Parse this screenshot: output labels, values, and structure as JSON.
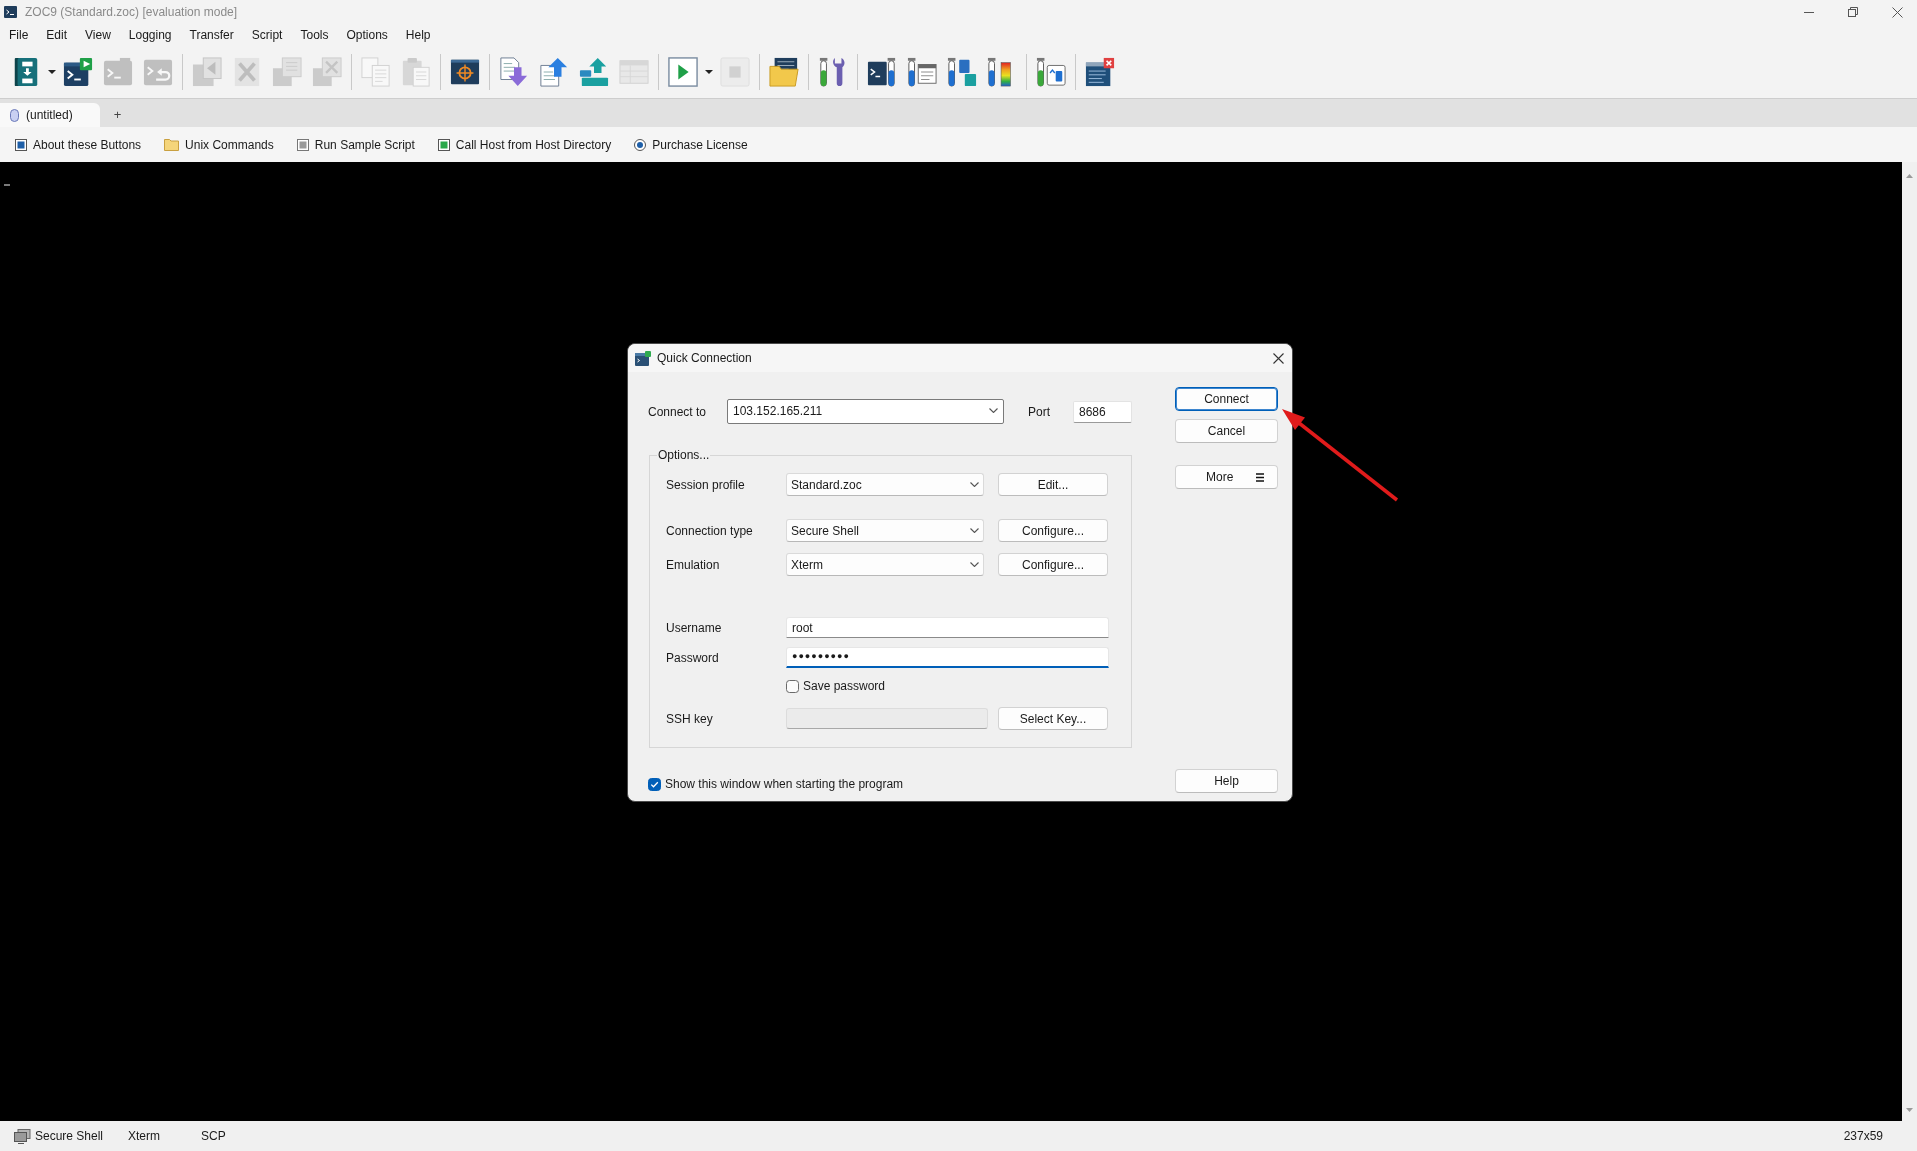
{
  "window": {
    "title": "ZOC9 (Standard.zoc) [evaluation mode]"
  },
  "menu": [
    "File",
    "Edit",
    "View",
    "Logging",
    "Transfer",
    "Script",
    "Tools",
    "Options",
    "Help"
  ],
  "toolbar": {
    "items": [
      {
        "kind": "button",
        "disabled": false
      },
      {
        "kind": "caret",
        "disabled": false
      },
      {
        "kind": "button",
        "disabled": false
      },
      {
        "kind": "button",
        "disabled": true
      },
      {
        "kind": "button",
        "disabled": true
      },
      {
        "kind": "separator"
      },
      {
        "kind": "button",
        "disabled": true
      },
      {
        "kind": "button",
        "disabled": true
      },
      {
        "kind": "button",
        "disabled": true
      },
      {
        "kind": "button",
        "disabled": true
      },
      {
        "kind": "separator"
      },
      {
        "kind": "button",
        "disabled": true
      },
      {
        "kind": "button",
        "disabled": true
      },
      {
        "kind": "separator"
      },
      {
        "kind": "button",
        "disabled": false
      },
      {
        "kind": "separator"
      },
      {
        "kind": "button",
        "disabled": false
      },
      {
        "kind": "button",
        "disabled": false
      },
      {
        "kind": "button",
        "disabled": false
      },
      {
        "kind": "button",
        "disabled": true
      },
      {
        "kind": "separator"
      },
      {
        "kind": "button",
        "disabled": false
      },
      {
        "kind": "caret",
        "disabled": false
      },
      {
        "kind": "button",
        "disabled": true
      },
      {
        "kind": "separator"
      },
      {
        "kind": "button",
        "disabled": false
      },
      {
        "kind": "separator"
      },
      {
        "kind": "button",
        "disabled": false
      },
      {
        "kind": "separator"
      },
      {
        "kind": "button",
        "disabled": false
      },
      {
        "kind": "button",
        "disabled": false
      },
      {
        "kind": "button",
        "disabled": false
      },
      {
        "kind": "button",
        "disabled": false
      },
      {
        "kind": "separator"
      },
      {
        "kind": "button",
        "disabled": false
      },
      {
        "kind": "separator"
      },
      {
        "kind": "button",
        "disabled": false
      }
    ]
  },
  "tabs": [
    {
      "label": "(untitled)",
      "selected": true
    }
  ],
  "new_tab": "+",
  "button_bar": [
    {
      "label": "About these Buttons"
    },
    {
      "label": "Unix Commands"
    },
    {
      "label": "Run Sample Script"
    },
    {
      "label": "Call Host from Host Directory"
    },
    {
      "label": "Purchase License"
    }
  ],
  "dialog": {
    "title": "Quick Connection",
    "connect_to": {
      "label": "Connect to",
      "value": "103.152.165.211"
    },
    "port": {
      "label": "Port",
      "value": "8686"
    },
    "options": {
      "legend": "Options...",
      "rows": [
        {
          "kind": "combo",
          "label": "Session profile",
          "value": "Standard.zoc",
          "button": "Edit..."
        },
        {
          "kind": "combo",
          "label": "Connection type",
          "value": "Secure Shell",
          "button": "Configure..."
        },
        {
          "kind": "combo",
          "label": "Emulation",
          "value": "Xterm",
          "button": "Configure..."
        },
        {
          "kind": "text",
          "label": "Username",
          "value": "root",
          "focused": false
        },
        {
          "kind": "text",
          "label": "Password",
          "value": "●●●●●●●●●",
          "focused": true
        },
        {
          "kind": "checkbox",
          "label": "Save password",
          "checked": false
        },
        {
          "kind": "key",
          "label": "SSH key",
          "disabled": true,
          "button": "Select Key..."
        }
      ]
    },
    "show_on_start": {
      "label": "Show this window when starting the program",
      "checked": true
    },
    "buttons": [
      {
        "label": "Connect",
        "kind": "push",
        "default": true
      },
      {
        "label": "Cancel",
        "kind": "push",
        "default": false
      },
      {
        "label": "More",
        "kind": "menu",
        "default": false
      },
      {
        "label": "Help",
        "kind": "push",
        "default": false
      }
    ]
  },
  "status_bar": {
    "items": [
      "Secure Shell",
      "Xterm",
      "SCP"
    ],
    "terminal_size": "237x59"
  }
}
